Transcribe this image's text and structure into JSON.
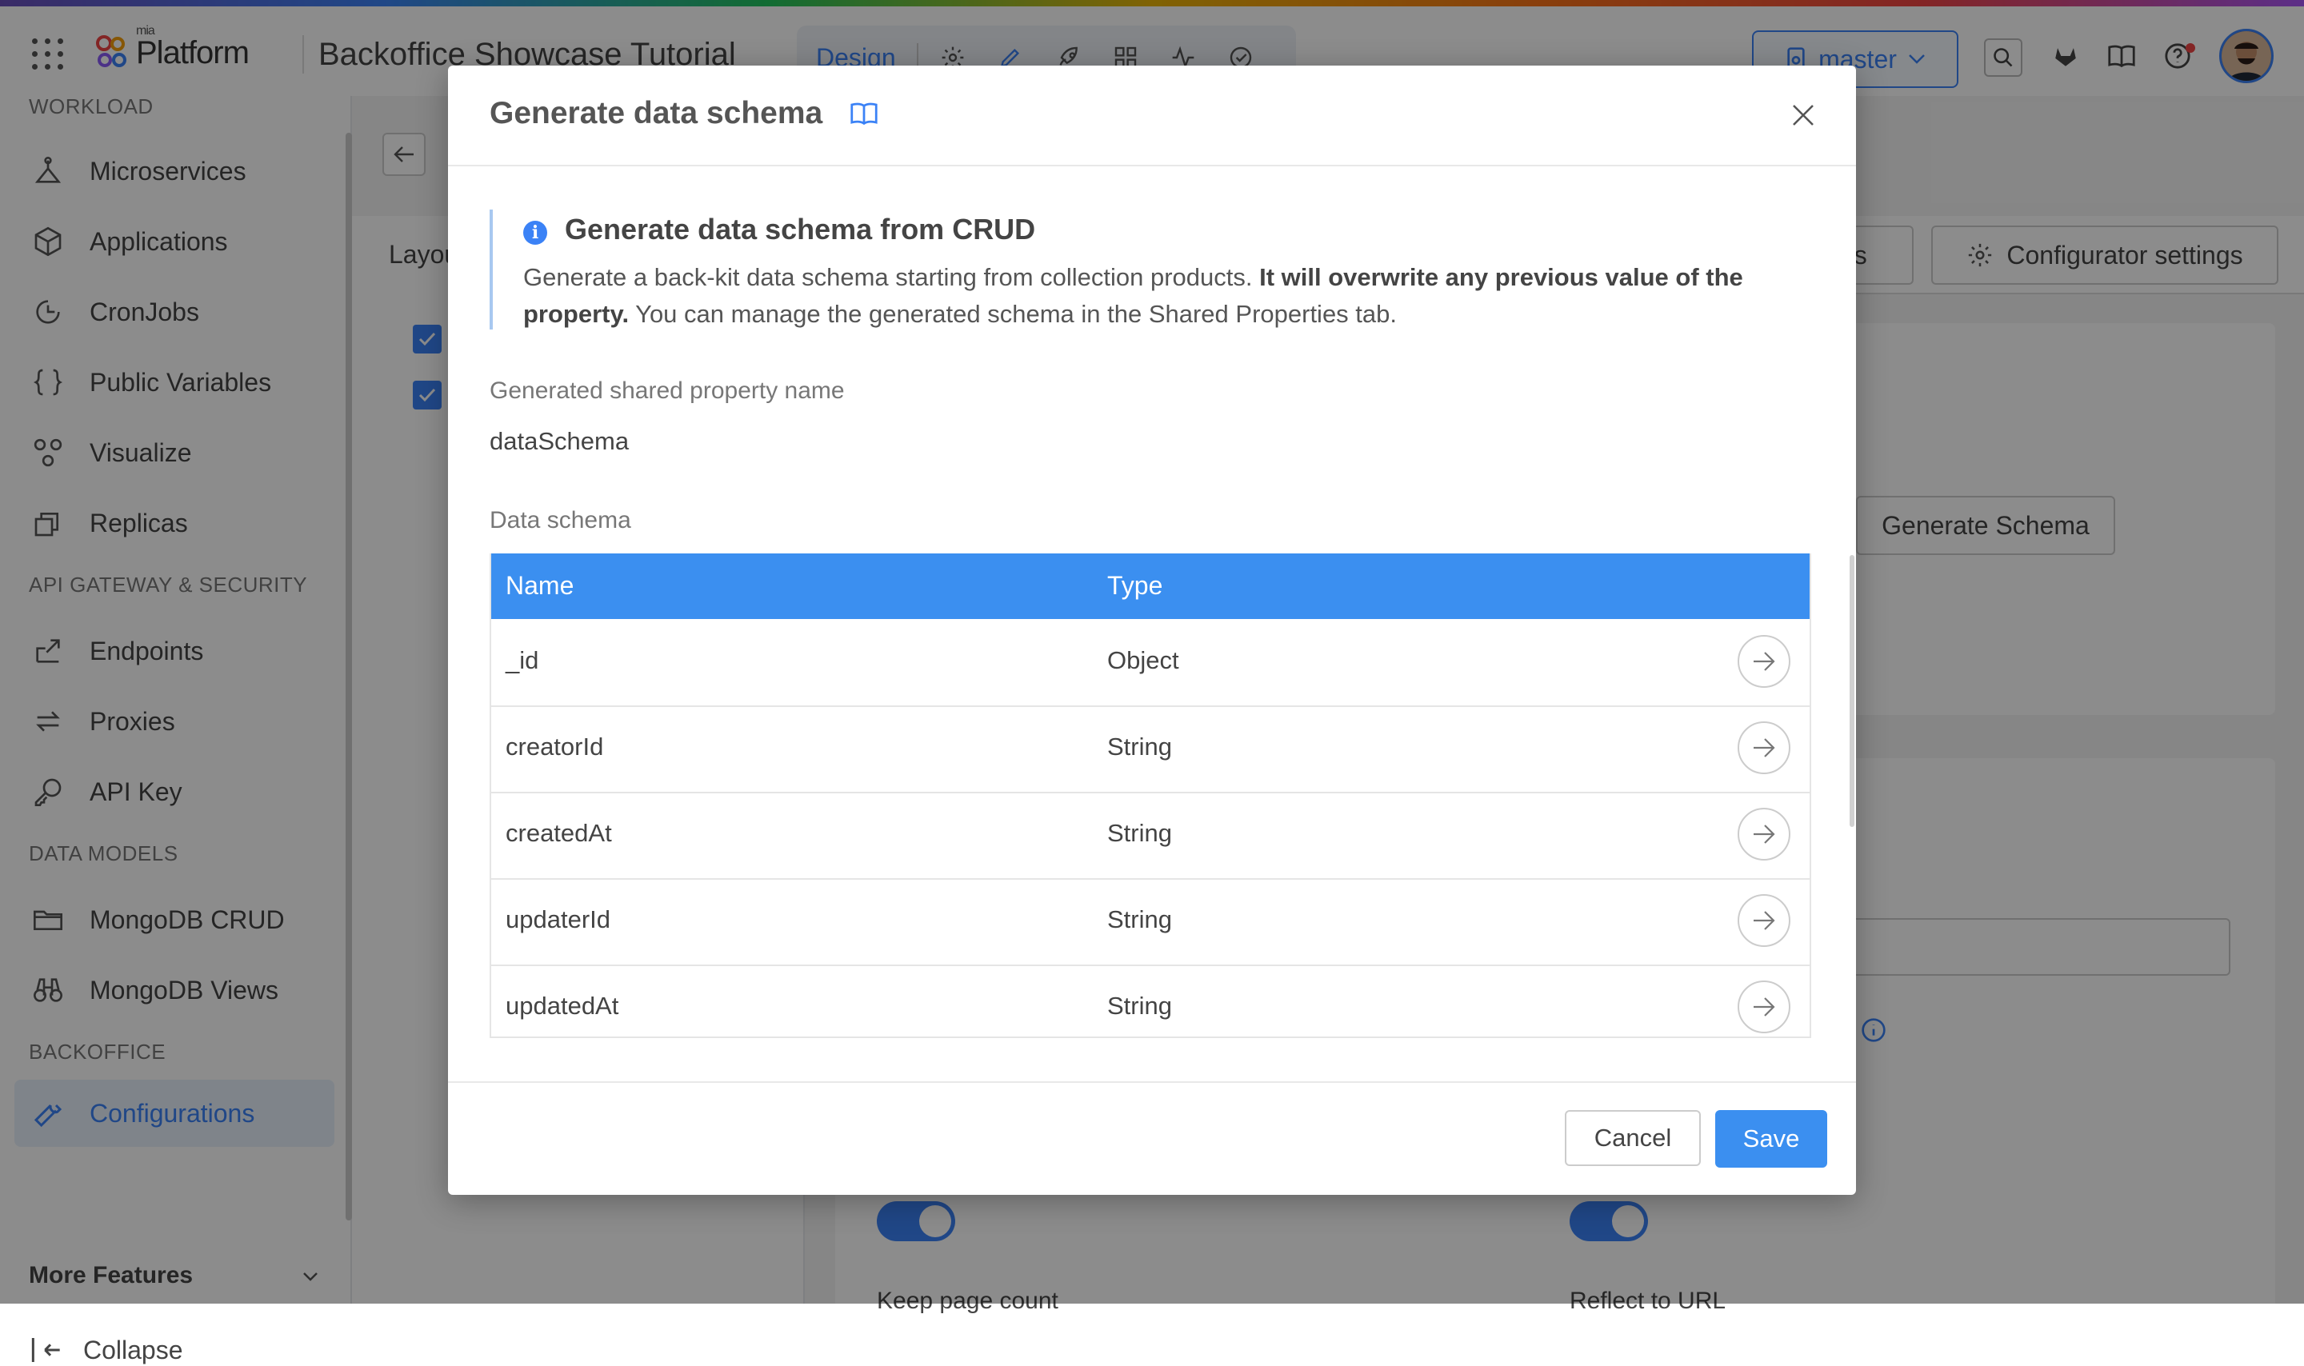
{
  "header": {
    "logo_small": "mia",
    "logo_text": "Platform",
    "project_title": "Backoffice Showcase Tutorial",
    "mode": "Design",
    "branch": "master"
  },
  "sidebar": {
    "sections": {
      "workload": "WORKLOAD",
      "api": "API GATEWAY & SECURITY",
      "data_models": "DATA MODELS",
      "backoffice": "BACKOFFICE"
    },
    "items": [
      {
        "label": "Microservices",
        "icon": "microservices-icon"
      },
      {
        "label": "Applications",
        "icon": "applications-icon"
      },
      {
        "label": "CronJobs",
        "icon": "cronjobs-icon"
      },
      {
        "label": "Public Variables",
        "icon": "braces-icon"
      },
      {
        "label": "Visualize",
        "icon": "visualize-icon"
      },
      {
        "label": "Replicas",
        "icon": "replicas-icon"
      },
      {
        "label": "Endpoints",
        "icon": "endpoints-icon"
      },
      {
        "label": "Proxies",
        "icon": "proxies-icon"
      },
      {
        "label": "API Key",
        "icon": "key-icon"
      },
      {
        "label": "MongoDB CRUD",
        "icon": "folder-icon"
      },
      {
        "label": "MongoDB Views",
        "icon": "binoculars-icon"
      },
      {
        "label": "Configurations",
        "icon": "wrench-icon"
      }
    ],
    "more_features": "More Features",
    "collapse": "Collapse"
  },
  "background": {
    "layout_tab": "Layou",
    "es_tab": "es",
    "configurator_settings": "Configurator settings",
    "generate_schema": "Generate Schema",
    "keep_page_count": "Keep page count",
    "reflect_to_url": "Reflect to URL"
  },
  "modal": {
    "title": "Generate data schema",
    "info": {
      "title": "Generate data schema from CRUD",
      "text_before": "Generate a back-kit data schema starting from collection products. ",
      "text_bold": "It will overwrite any previous value of the property.",
      "text_after": " You can manage the generated schema in the Shared Properties tab."
    },
    "shared_property_label": "Generated shared property name",
    "shared_property_value": "dataSchema",
    "data_schema_label": "Data schema",
    "table": {
      "columns": [
        "Name",
        "Type"
      ],
      "rows": [
        {
          "name": "_id",
          "type": "Object"
        },
        {
          "name": "creatorId",
          "type": "String"
        },
        {
          "name": "createdAt",
          "type": "String"
        },
        {
          "name": "updaterId",
          "type": "String"
        },
        {
          "name": "updatedAt",
          "type": "String"
        }
      ]
    },
    "cancel": "Cancel",
    "save": "Save"
  },
  "colors": {
    "accent": "#3b82f6",
    "table_header": "#3b8ff0"
  }
}
